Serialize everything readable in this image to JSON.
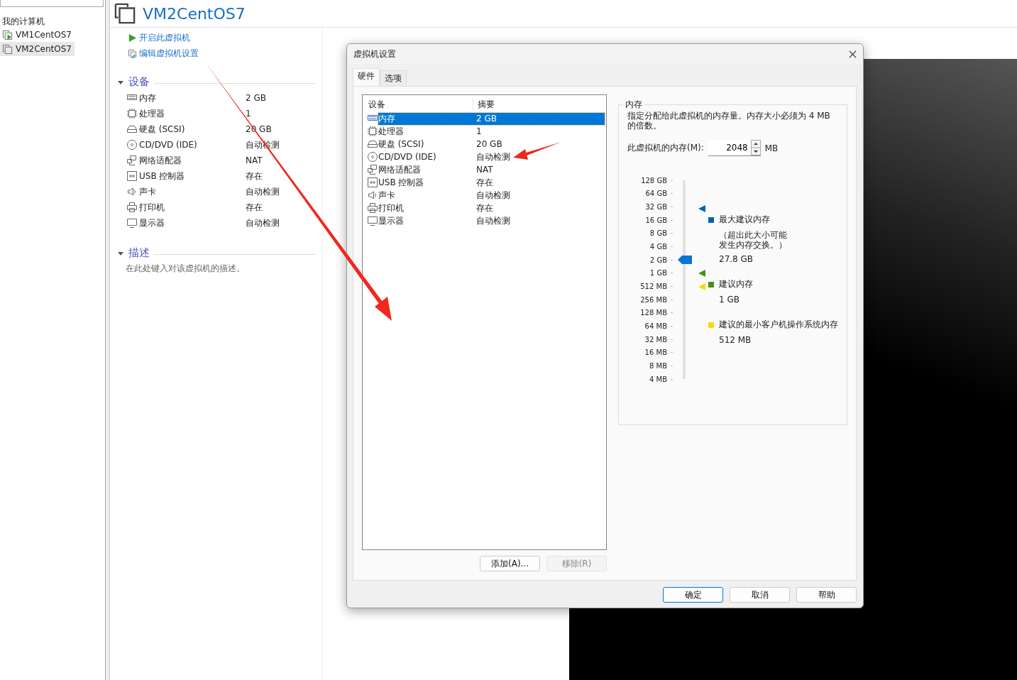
{
  "sidebar": {
    "heading": "我的计算机",
    "items": [
      {
        "label": "VM1CentOS7",
        "selected": false,
        "running": true
      },
      {
        "label": "VM2CentOS7",
        "selected": true,
        "running": false
      }
    ]
  },
  "vm": {
    "title": "VM2CentOS7",
    "actions": [
      {
        "kind": "power_on",
        "label": "开启此虚拟机"
      },
      {
        "kind": "edit",
        "label": "编辑虚拟机设置"
      }
    ],
    "devices_heading": "设备",
    "devices": [
      {
        "kind": "memory",
        "name": "内存",
        "summary": "2 GB"
      },
      {
        "kind": "cpu",
        "name": "处理器",
        "summary": "1"
      },
      {
        "kind": "disk",
        "name": "硬盘 (SCSI)",
        "summary": "20 GB"
      },
      {
        "kind": "cdrom",
        "name": "CD/DVD (IDE)",
        "summary": "自动检测"
      },
      {
        "kind": "network",
        "name": "网络适配器",
        "summary": "NAT"
      },
      {
        "kind": "usb",
        "name": "USB 控制器",
        "summary": "存在"
      },
      {
        "kind": "sound",
        "name": "声卡",
        "summary": "自动检测"
      },
      {
        "kind": "printer",
        "name": "打印机",
        "summary": "存在"
      },
      {
        "kind": "display",
        "name": "显示器",
        "summary": "自动检测"
      }
    ],
    "description_heading": "描述",
    "description_placeholder": "在此处键入对该虚拟机的描述。"
  },
  "dialog": {
    "title": "虚拟机设置",
    "tabs": [
      {
        "label": "硬件",
        "selected": true
      },
      {
        "label": "选项",
        "selected": false
      }
    ],
    "table": {
      "columns": [
        "设备",
        "摘要"
      ],
      "rows": [
        {
          "kind": "memory",
          "device": "内存",
          "summary": "2 GB",
          "selected": true
        },
        {
          "kind": "cpu",
          "device": "处理器",
          "summary": "1",
          "selected": false
        },
        {
          "kind": "disk",
          "device": "硬盘 (SCSI)",
          "summary": "20 GB",
          "selected": false
        },
        {
          "kind": "cdrom",
          "device": "CD/DVD (IDE)",
          "summary": "自动检测",
          "selected": false
        },
        {
          "kind": "network",
          "device": "网络适配器",
          "summary": "NAT",
          "selected": false
        },
        {
          "kind": "usb",
          "device": "USB 控制器",
          "summary": "存在",
          "selected": false
        },
        {
          "kind": "sound",
          "device": "声卡",
          "summary": "自动检测",
          "selected": false
        },
        {
          "kind": "printer",
          "device": "打印机",
          "summary": "存在",
          "selected": false
        },
        {
          "kind": "display",
          "device": "显示器",
          "summary": "自动检测",
          "selected": false
        }
      ]
    },
    "add_button": {
      "label": "添加(A)...",
      "disabled": false
    },
    "remove_button": {
      "label": "移除(R)",
      "disabled": true
    },
    "memory": {
      "heading": "内存",
      "description": "指定分配给此虚拟机的内存量。内存大小必须为 4 MB 的倍数。",
      "field_label": "此虚拟机的内存(M):",
      "value": "2048",
      "unit": "MB",
      "scale": [
        "128 GB",
        "64 GB",
        "32 GB",
        "16 GB",
        "8 GB",
        "4 GB",
        "2 GB",
        "1 GB",
        "512 MB",
        "256 MB",
        "128 MB",
        "64 MB",
        "32 MB",
        "16 MB",
        "8 MB",
        "4 MB"
      ],
      "level": 0.6,
      "legend": [
        {
          "label": "最大建议内存",
          "note": "（超出此大小可能发生内存交换。）",
          "value": "27.8 GB",
          "color": "#0063b1"
        },
        {
          "label": "建议内存",
          "value": "1 GB",
          "color": "#4a8f1a"
        },
        {
          "label": "建议的最小客户机操作系统内存",
          "value": "512 MB",
          "color": "#ffd800"
        }
      ],
      "markers": [
        {
          "color": "#0063b1",
          "level": 0.857
        },
        {
          "color": "#4a8f1a",
          "level": 0.533
        },
        {
          "color": "#ffd800",
          "level": 0.467
        }
      ]
    },
    "buttons": [
      {
        "label": "确定",
        "default": true
      },
      {
        "label": "取消",
        "default": false
      },
      {
        "label": "帮助",
        "default": false
      }
    ]
  }
}
